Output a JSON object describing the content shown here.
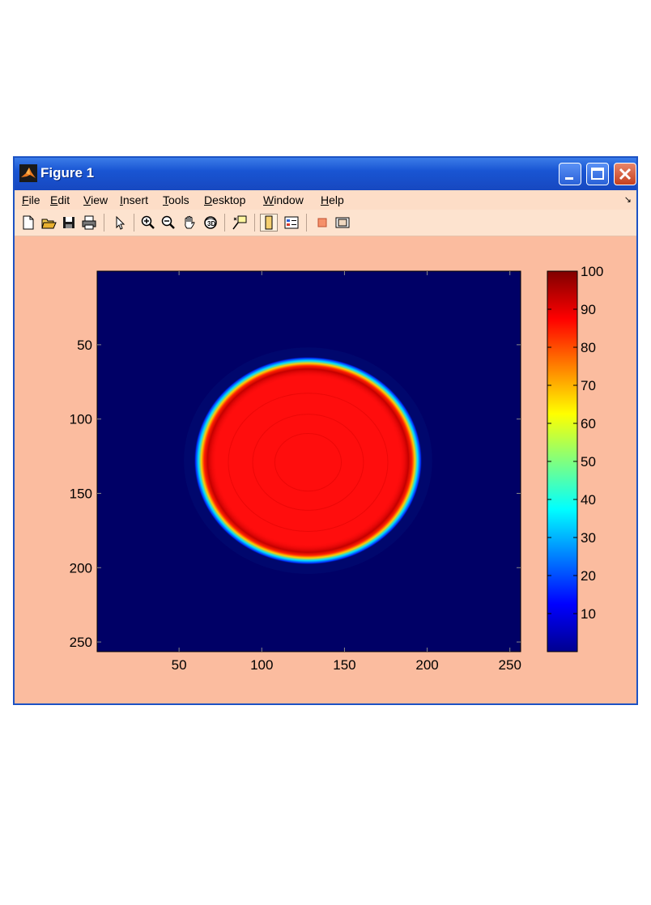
{
  "window": {
    "title": "Figure 1"
  },
  "menu": {
    "items": [
      {
        "label": "File",
        "accel": "F",
        "rest": "ile"
      },
      {
        "label": "Edit",
        "accel": "E",
        "rest": "dit"
      },
      {
        "label": "View",
        "accel": "V",
        "rest": "iew"
      },
      {
        "label": "Insert",
        "accel": "I",
        "rest": "nsert"
      },
      {
        "label": "Tools",
        "accel": "T",
        "rest": "ools"
      },
      {
        "label": "Desktop",
        "accel": "D",
        "rest": "esktop"
      },
      {
        "label": "Window",
        "accel": "W",
        "rest": "indow"
      },
      {
        "label": "Help",
        "accel": "H",
        "rest": "elp"
      }
    ]
  },
  "toolbar": {
    "icons": [
      "new-file-icon",
      "open-folder-icon",
      "save-icon",
      "print-icon",
      "pointer-arrow-icon",
      "zoom-in-icon",
      "zoom-out-icon",
      "pan-hand-icon",
      "rotate-3d-icon",
      "data-cursor-icon",
      "colorbar-icon",
      "legend-icon",
      "hide-plot-tools-icon",
      "show-plot-tools-icon"
    ]
  },
  "chart_data": {
    "type": "heatmap",
    "description_kind": "image of a circular region with value ~90 on a background of 0",
    "x_ticks": [
      50,
      100,
      150,
      200,
      250
    ],
    "y_ticks": [
      50,
      100,
      150,
      200,
      250
    ],
    "x_range": [
      1,
      256
    ],
    "y_range": [
      1,
      256
    ],
    "y_reversed": true,
    "circle_center": [
      128,
      128
    ],
    "circle_radius_x": 67,
    "circle_radius_y": 68,
    "inside_value": 90,
    "background_value": 0,
    "colormap": "jet",
    "colorbar": {
      "range": [
        0,
        100
      ],
      "ticks": [
        10,
        20,
        30,
        40,
        50,
        60,
        70,
        80,
        90,
        100
      ]
    },
    "colors": {
      "background": "#000066",
      "inside": "#ff0d0d"
    }
  }
}
